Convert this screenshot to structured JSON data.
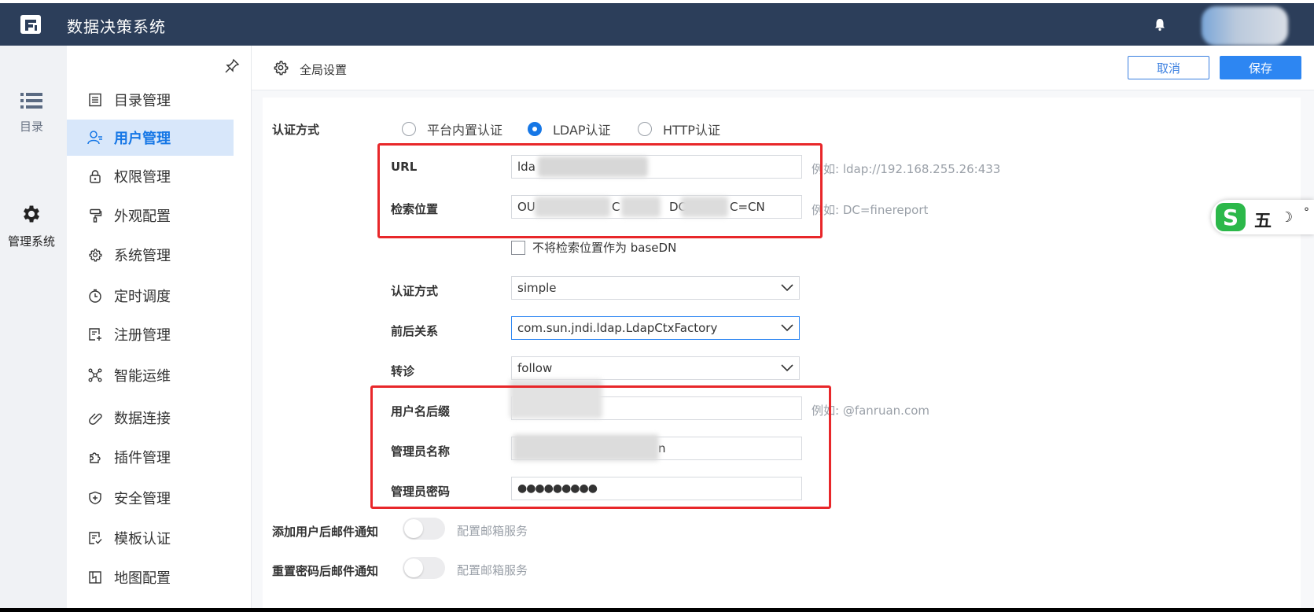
{
  "app": {
    "title": "数据决策系统"
  },
  "left_nav": [
    {
      "label": "目录",
      "icon": "list-icon"
    },
    {
      "label": "管理系统",
      "icon": "gear-icon"
    }
  ],
  "menu": {
    "items": [
      {
        "label": "目录管理",
        "icon": "catalog-icon"
      },
      {
        "label": "用户管理",
        "icon": "user-manage-icon"
      },
      {
        "label": "权限管理",
        "icon": "lock-icon"
      },
      {
        "label": "外观配置",
        "icon": "paint-roller-icon"
      },
      {
        "label": "系统管理",
        "icon": "gear-icon"
      },
      {
        "label": "定时调度",
        "icon": "timer-icon"
      },
      {
        "label": "注册管理",
        "icon": "register-icon"
      },
      {
        "label": "智能运维",
        "icon": "network-icon"
      },
      {
        "label": "数据连接",
        "icon": "link-icon"
      },
      {
        "label": "插件管理",
        "icon": "puzzle-icon"
      },
      {
        "label": "安全管理",
        "icon": "shield-icon"
      },
      {
        "label": "模板认证",
        "icon": "template-icon"
      },
      {
        "label": "地图配置",
        "icon": "map-icon"
      }
    ],
    "selected": "用户管理"
  },
  "header": {
    "breadcrumb": "全局设置",
    "cancel_label": "取消",
    "save_label": "保存"
  },
  "form": {
    "auth_method_label": "认证方式",
    "radio_options": [
      "平台内置认证",
      "LDAP认证",
      "HTTP认证"
    ],
    "radio_selected": "LDAP认证",
    "url": {
      "label": "URL",
      "value_prefix": "lda",
      "hint": "例如: ldap://192.168.255.26:433"
    },
    "search_base": {
      "label": "检索位置",
      "value_start": "OU",
      "value_mid1": "C",
      "value_mid2": "DC=",
      "value_end": "C=CN",
      "hint": "例如: DC=finereport"
    },
    "basedn_checkbox": {
      "label": "不将检索位置作为 baseDN",
      "checked": false
    },
    "auth_type": {
      "label": "认证方式",
      "value": "simple"
    },
    "context_factory": {
      "label": "前后关系",
      "value": "com.sun.jndi.ldap.LdapCtxFactory"
    },
    "referral": {
      "label": "转诊",
      "value": "follow"
    },
    "username_suffix": {
      "label": "用户名后缀",
      "hint": "例如: @fanruan.com"
    },
    "admin_name": {
      "label": "管理员名称",
      "value_end": "n"
    },
    "admin_password": {
      "label": "管理员密码",
      "value": "●●●●●●●●●"
    },
    "mail_on_add": {
      "label": "添加用户后邮件通知",
      "toggle_text": "配置邮箱服务",
      "enabled": false
    },
    "mail_on_reset": {
      "label": "重置密码后邮件通知",
      "toggle_text": "配置邮箱服务",
      "enabled": false
    }
  },
  "ime": {
    "logo": "S",
    "mode": "五",
    "moon": "☽",
    "symbol": "°"
  },
  "colors": {
    "topbar": "#2c3e5a",
    "accent": "#2d86f2",
    "highlight_box": "#e8272a",
    "menu_selected": "#d8e7fa"
  }
}
